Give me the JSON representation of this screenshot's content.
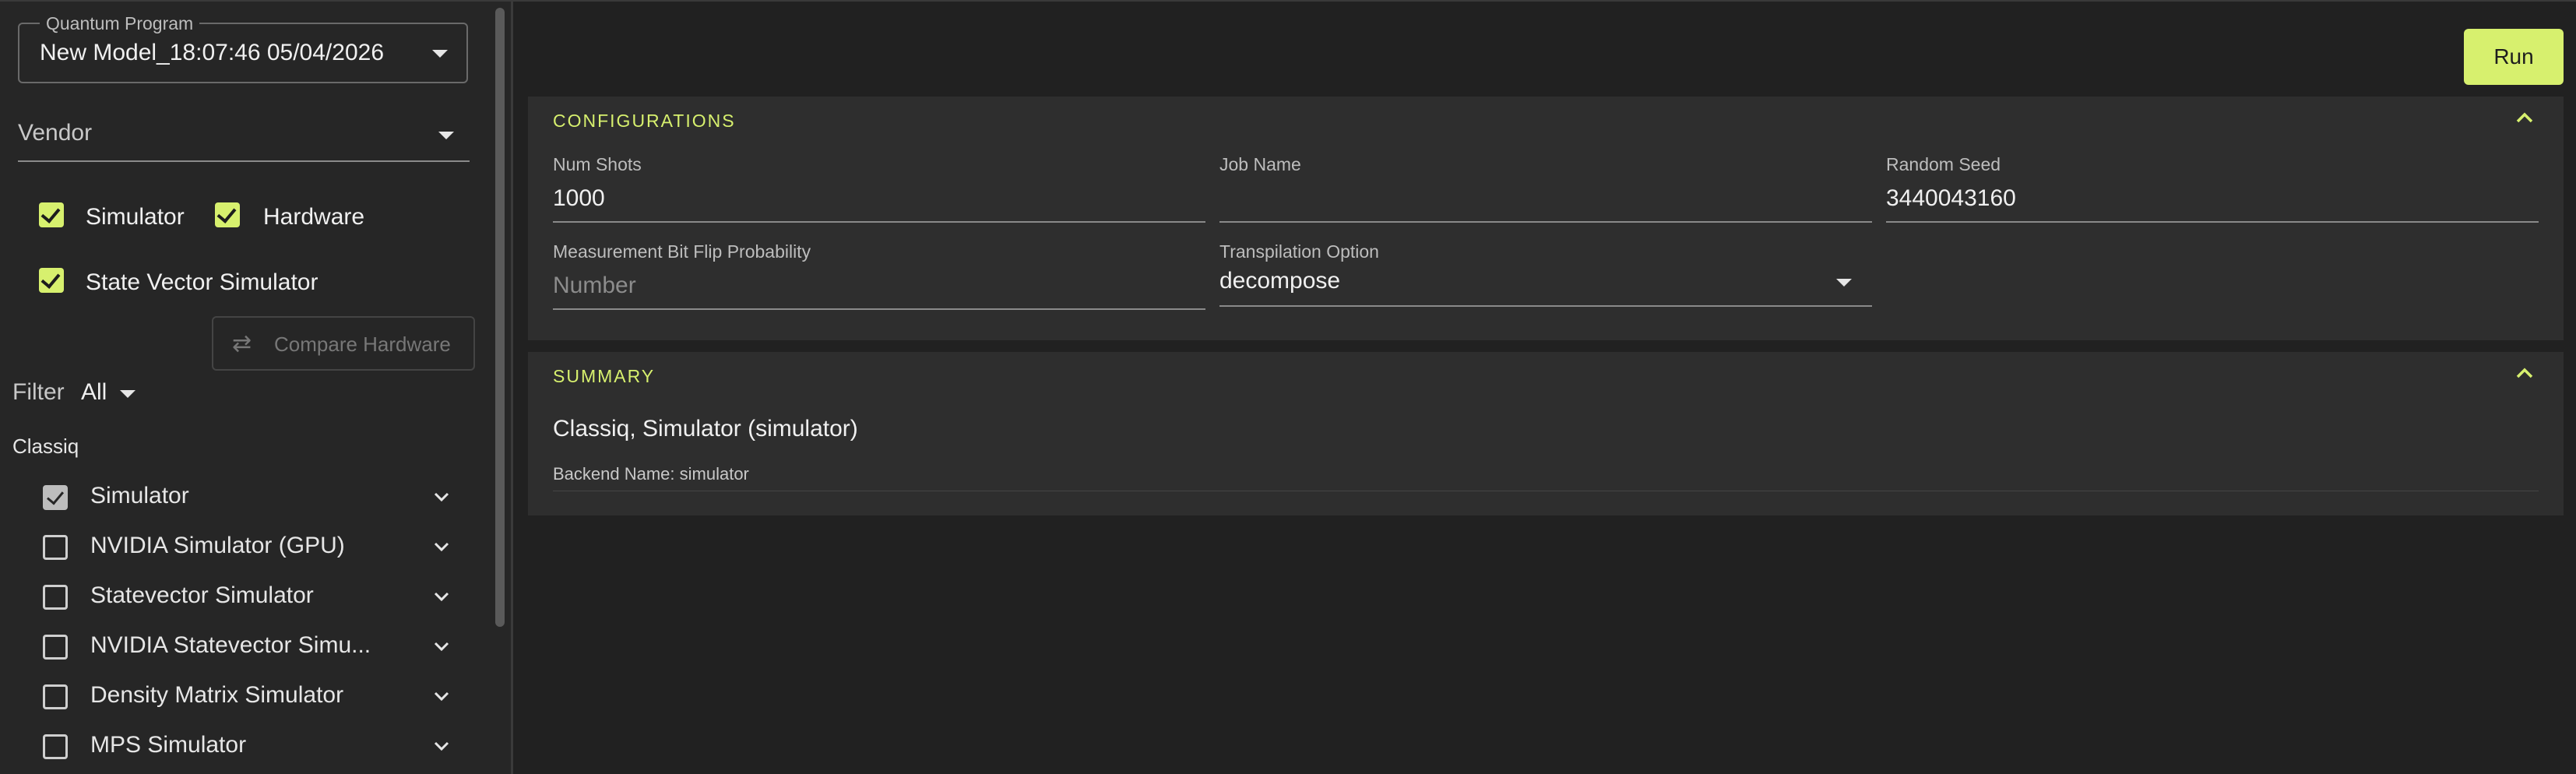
{
  "sidebar": {
    "program": {
      "legend": "Quantum Program",
      "value": "New Model_18:07:46 05/04/2026"
    },
    "vendor": {
      "label": "Vendor"
    },
    "type_filters": [
      {
        "label": "Simulator",
        "checked": true
      },
      {
        "label": "Hardware",
        "checked": true
      },
      {
        "label": "State Vector Simulator",
        "checked": true
      }
    ],
    "compare_button": "Compare Hardware",
    "filter": {
      "label": "Filter",
      "value": "All"
    },
    "provider": "Classiq",
    "backends": [
      {
        "label": "Simulator",
        "checked": true
      },
      {
        "label": "NVIDIA Simulator (GPU)",
        "checked": false
      },
      {
        "label": "Statevector Simulator",
        "checked": false
      },
      {
        "label": "NVIDIA Statevector Simu...",
        "checked": false
      },
      {
        "label": "Density Matrix Simulator",
        "checked": false
      },
      {
        "label": "MPS Simulator",
        "checked": false
      }
    ]
  },
  "main": {
    "run_button": "Run",
    "configurations": {
      "title": "CONFIGURATIONS",
      "num_shots": {
        "label": "Num Shots",
        "value": "1000"
      },
      "job_name": {
        "label": "Job Name",
        "value": ""
      },
      "random_seed": {
        "label": "Random Seed",
        "value": "3440043160"
      },
      "bit_flip": {
        "label": "Measurement Bit Flip Probability",
        "placeholder": "Number"
      },
      "transpilation": {
        "label": "Transpilation Option",
        "value": "decompose"
      }
    },
    "summary": {
      "title": "SUMMARY",
      "selection": "Classiq, Simulator (simulator)",
      "backend_name": "Backend Name: simulator"
    }
  },
  "colors": {
    "accent": "#d7f06e",
    "background": "#212121",
    "panel": "#2e2e2e",
    "sidebar": "#262626"
  }
}
